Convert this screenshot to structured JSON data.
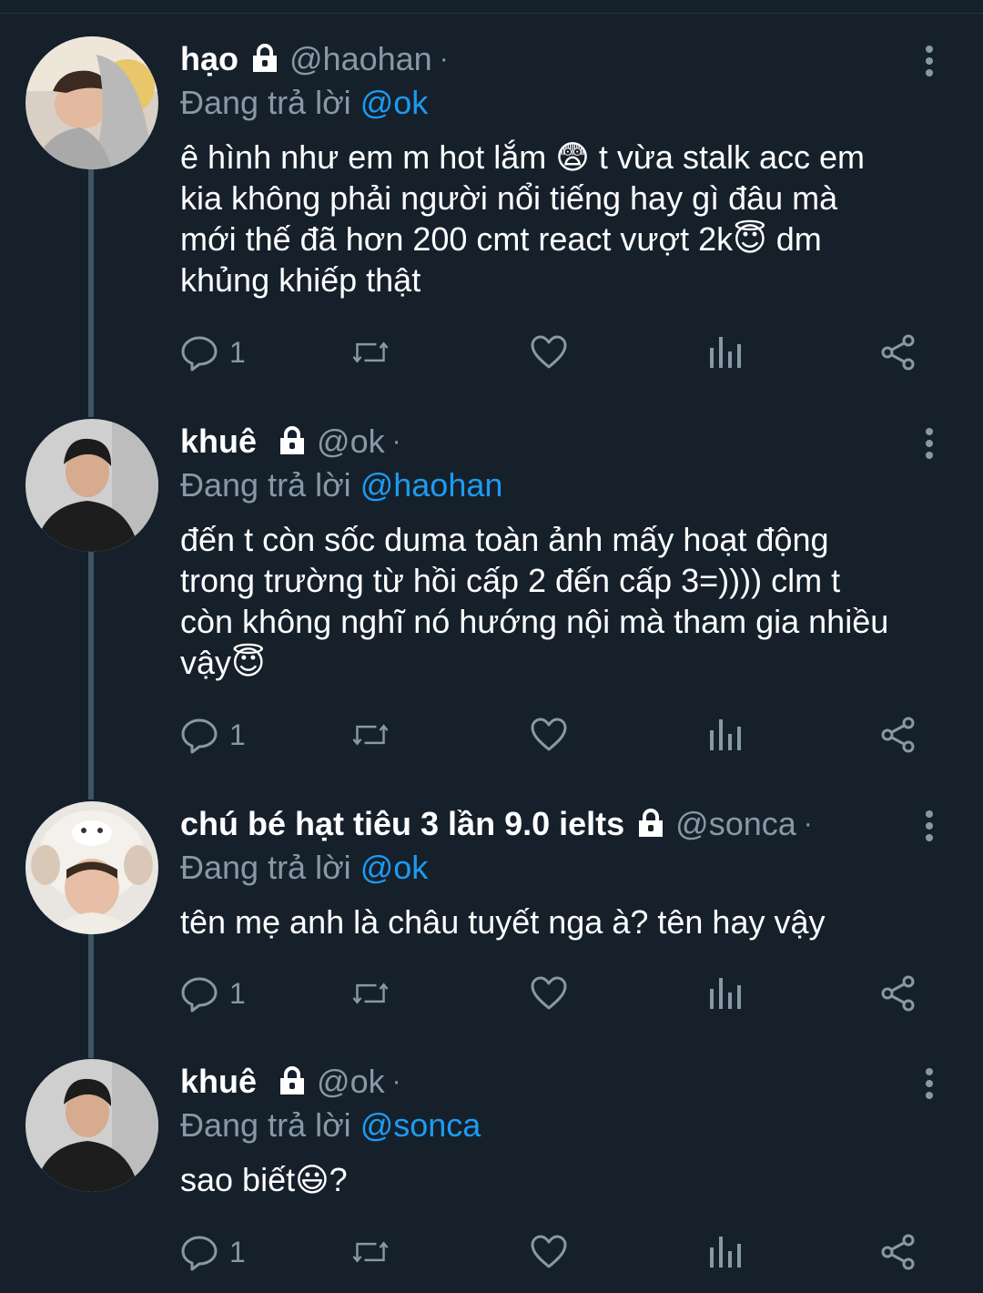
{
  "tweets": [
    {
      "name": "hạo",
      "handle": "@haohan",
      "dot": "·",
      "replying_label": "Đang trả lời",
      "replying_to": "@ok",
      "text": "ê hình như em m hot lắm 😨 t vừa stalk acc em\nkia không phải người nổi tiếng hay gì đâu mà\nmới thế đã hơn 200 cmt react vượt 2k😇 dm\nkhủng khiếp thật",
      "reply_count": "1"
    },
    {
      "name": "khuê",
      "handle": "@ok",
      "dot": "·",
      "replying_label": "Đang trả lời",
      "replying_to": "@haohan",
      "text": "đến t còn sốc duma toàn ảnh mấy hoạt động\ntrong trường từ hồi cấp 2 đến cấp 3=)))) clm t\ncòn không nghĩ nó hướng nội mà tham gia nhiều\nvậy😇",
      "reply_count": "1"
    },
    {
      "name": "chú bé hạt tiêu 3 lần 9.0 ielts",
      "handle": "@sonca",
      "dot": "·",
      "replying_label": "Đang trả lời",
      "replying_to": "@ok",
      "text": "tên mẹ anh là châu tuyết nga à? tên hay vậy",
      "reply_count": "1"
    },
    {
      "name": "khuê",
      "handle": "@ok",
      "dot": "·",
      "replying_label": "Đang trả lời",
      "replying_to": "@sonca",
      "text": "sao biết😃?",
      "reply_count": "1"
    }
  ],
  "icons": {
    "reply": "reply-icon",
    "retweet": "retweet-icon",
    "like": "like-icon",
    "analytics": "analytics-icon",
    "share": "share-icon",
    "lock": "lock-icon",
    "more": "more-vertical-icon"
  },
  "colors": {
    "background": "#15202b",
    "secondary_text": "#8899a6",
    "mention": "#1d9bf0",
    "thread_line": "#3d5466"
  }
}
